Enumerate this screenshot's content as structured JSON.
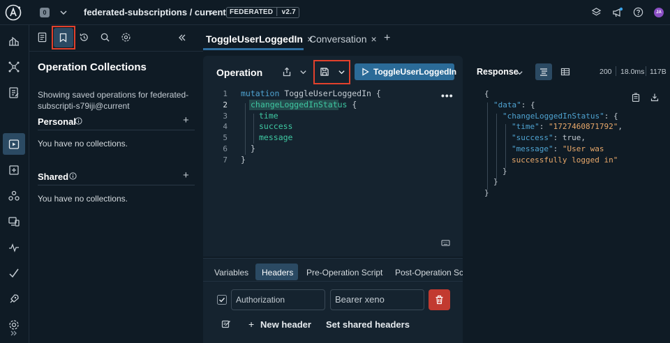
{
  "topbar": {
    "org_badge": "0",
    "graph_name": "federated-subscriptions / current",
    "badge_left": "FEDERATED",
    "badge_version": "v2.7",
    "avatar_initials": "JA",
    "icons": [
      "schema-stack-icon",
      "megaphone-icon",
      "help-icon",
      "avatar"
    ]
  },
  "leftnav": {
    "items": [
      "home-icon",
      "graph-icon",
      "schema-icon",
      "explorer-icon",
      "checks-icon",
      "federation-icon",
      "clients-icon",
      "insights-icon",
      "check-icon",
      "launches-icon",
      "settings-icon",
      "expand-icon"
    ],
    "active": "explorer-icon"
  },
  "collections": {
    "toolbar": [
      "documentation-icon",
      "bookmark-icon",
      "history-icon",
      "search-icon",
      "settings-icon",
      "collapse-icon"
    ],
    "title": "Operation Collections",
    "description": "Showing saved operations for federated-subscripti-s79iji@current",
    "personal": {
      "title": "Personal",
      "empty": "You have no collections."
    },
    "shared": {
      "title": "Shared",
      "empty": "You have no collections."
    }
  },
  "tabs": [
    {
      "label": "ToggleUserLoggedIn",
      "close": "×",
      "active": true
    },
    {
      "label": "Conversation",
      "close": "×",
      "active": false
    }
  ],
  "add_tab": "+",
  "operation": {
    "label": "Operation",
    "run_label": "ToggleUserLoggedIn",
    "code": [
      {
        "n": "1",
        "parts": [
          {
            "c": "kw",
            "t": "mutation "
          },
          {
            "c": "br",
            "t": "ToggleUserLoggedIn {"
          }
        ]
      },
      {
        "n": "2",
        "parts": [
          {
            "c": "fld",
            "t": "changeLoggedInStatus"
          },
          {
            "c": "br",
            "t": " {"
          }
        ]
      },
      {
        "n": "3",
        "parts": [
          {
            "c": "fld",
            "t": "time"
          }
        ]
      },
      {
        "n": "4",
        "parts": [
          {
            "c": "fld",
            "t": "success"
          }
        ]
      },
      {
        "n": "5",
        "parts": [
          {
            "c": "fld",
            "t": "message"
          }
        ]
      },
      {
        "n": "6",
        "parts": [
          {
            "c": "br",
            "t": "}"
          }
        ]
      },
      {
        "n": "7",
        "parts": [
          {
            "c": "br",
            "t": "}"
          }
        ]
      }
    ]
  },
  "variables": {
    "tabs": [
      "Variables",
      "Headers",
      "Pre-Operation Script",
      "Post-Operation Scr"
    ],
    "active_tab": "Headers",
    "header_key": "Authorization",
    "header_value": "Bearer xeno",
    "new_header": "New header",
    "set_shared": "Set shared headers",
    "plus": "+"
  },
  "response": {
    "label": "Response",
    "status": "200",
    "time": "18.0ms",
    "size": "117B",
    "lines": [
      [
        {
          "c": "rb",
          "t": "{"
        }
      ],
      [
        {
          "c": "rk",
          "t": "\"data\""
        },
        {
          "c": "rb",
          "t": ": {"
        }
      ],
      [
        {
          "c": "rk",
          "t": "\"changeLoggedInStatus\""
        },
        {
          "c": "rb",
          "t": ": {"
        }
      ],
      [
        {
          "c": "rk",
          "t": "\"time\""
        },
        {
          "c": "rb",
          "t": ": "
        },
        {
          "c": "rs",
          "t": "\"1727460871792\""
        },
        {
          "c": "rb",
          "t": ","
        }
      ],
      [
        {
          "c": "rk",
          "t": "\"success\""
        },
        {
          "c": "rb",
          "t": ": true,"
        }
      ],
      [
        {
          "c": "rk",
          "t": "\"message\""
        },
        {
          "c": "rb",
          "t": ": "
        },
        {
          "c": "rs",
          "t": "\"User was"
        }
      ],
      [
        {
          "c": "rs",
          "t": "successfully logged in\""
        }
      ],
      [
        {
          "c": "rb",
          "t": "}"
        }
      ],
      [
        {
          "c": "rb",
          "t": "}"
        }
      ],
      [
        {
          "c": "rb",
          "t": "}"
        }
      ]
    ]
  },
  "colors": {
    "background": "#0f1b25",
    "panel": "#15232f",
    "accent": "#2b6b98",
    "highlight_box": "#e2412c",
    "delete": "#c23a30"
  }
}
